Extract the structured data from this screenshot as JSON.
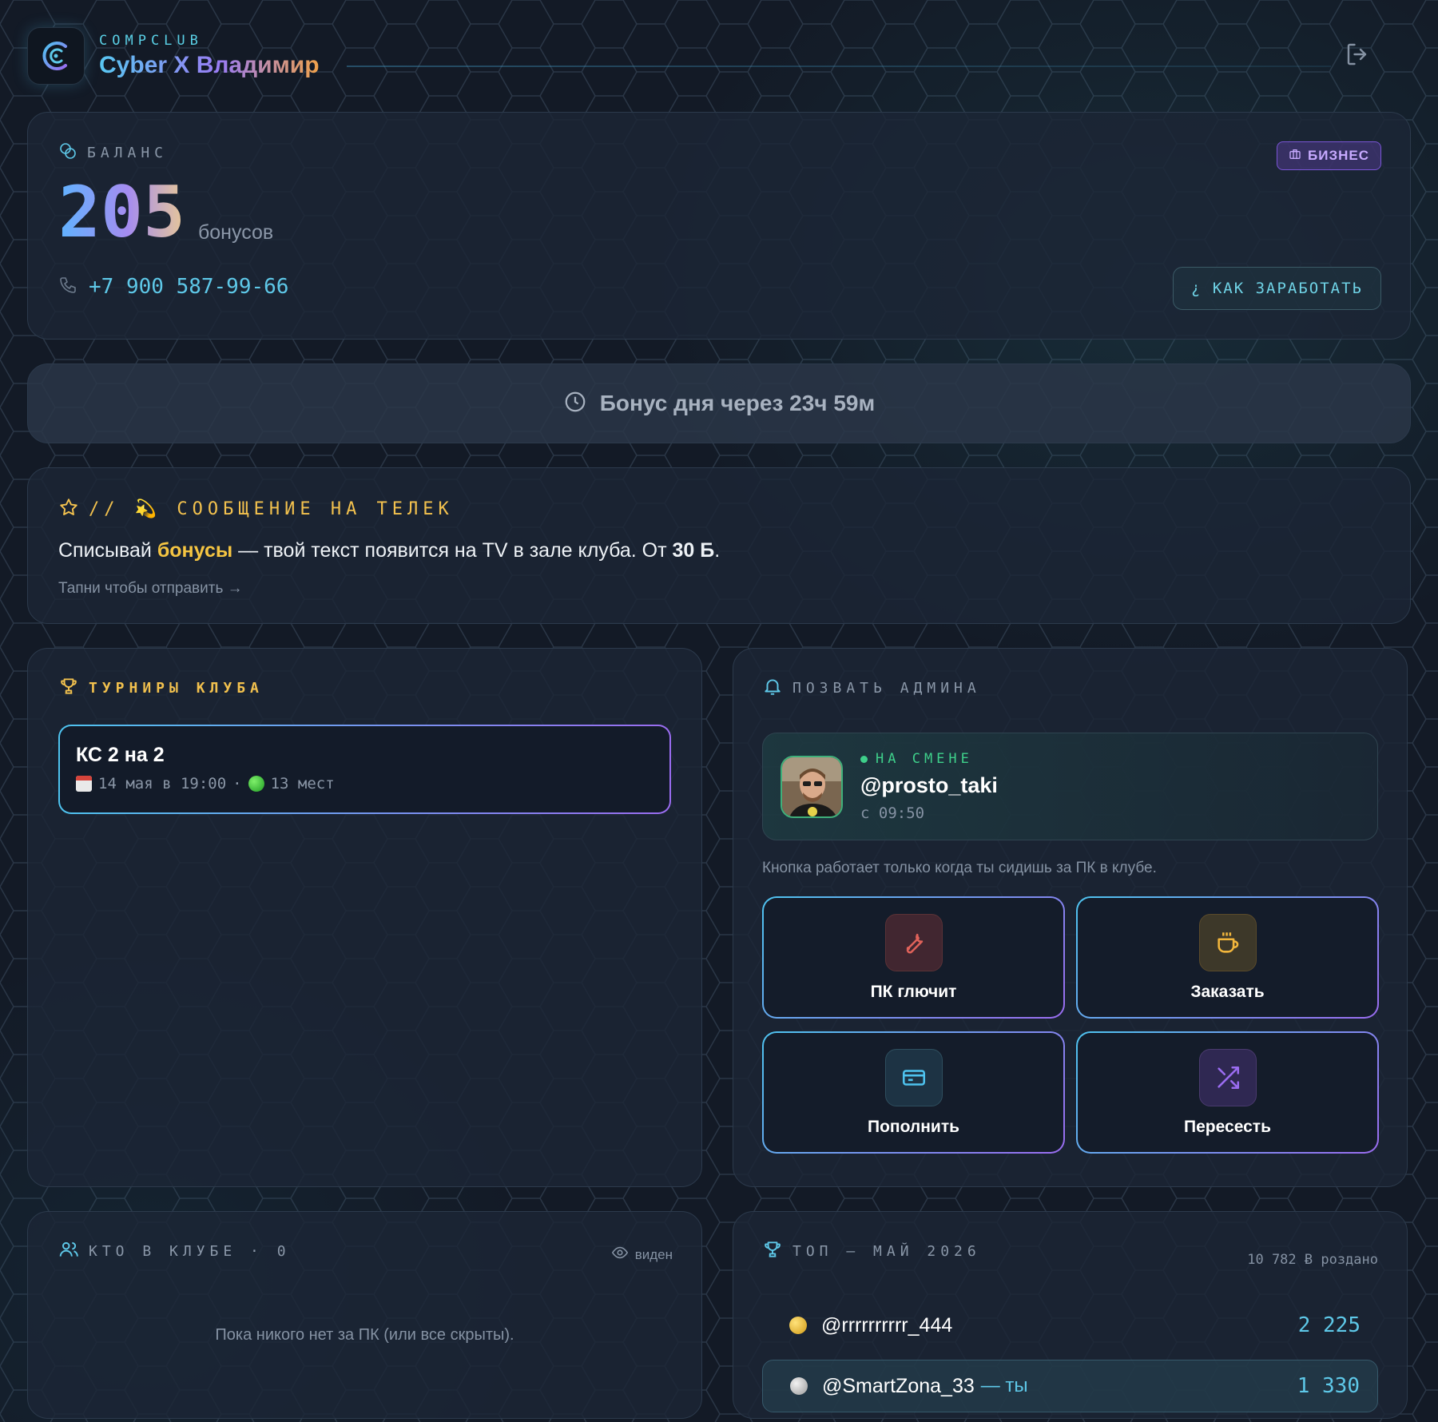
{
  "header": {
    "brand_small": "COMPCLUB",
    "brand_title": "Cyber X Владимир",
    "logo_icon": "c-logo-icon",
    "logout_icon": "logout-icon"
  },
  "balance": {
    "label": "БАЛАНС",
    "badge": "БИЗНЕС",
    "value": "205",
    "unit": "бонусов",
    "phone": "+7 900 587-99-66",
    "earn_button": "¿ КАК ЗАРАБОТАТЬ"
  },
  "daily_bonus": {
    "text": "Бонус дня через 23ч 59м"
  },
  "tv_message": {
    "title": "// 💫 СООБЩЕНИЕ НА ТЕЛЕК",
    "text_before": "Списывай ",
    "text_highlight": "бонусы",
    "text_middle": " — твой текст появится на TV в зале клуба. От ",
    "text_bold": "30 Б",
    "text_after": ".",
    "hint": "Тапни чтобы отправить →"
  },
  "tournaments": {
    "title": "ТУРНИРЫ КЛУБА",
    "items": [
      {
        "name": "КС 2 на 2",
        "date": "14 мая в 19:00",
        "sep": "·",
        "slots": "13 мест"
      }
    ]
  },
  "call_admin": {
    "title": "ПОЗВАТЬ АДМИНА",
    "status": "НА СМЕНЕ",
    "nick": "@prosto_taki",
    "since": "с 09:50",
    "note": "Кнопка работает только когда ты сидишь за ПК в клубе.",
    "actions": [
      {
        "label": "ПК глючит",
        "icon": "wrench-icon",
        "color": "#e0625a"
      },
      {
        "label": "Заказать",
        "icon": "coffee-icon",
        "color": "#f2b63c"
      },
      {
        "label": "Пополнить",
        "icon": "card-icon",
        "color": "#4ec3ef"
      },
      {
        "label": "Пересесть",
        "icon": "shuffle-icon",
        "color": "#9a6cf0"
      }
    ]
  },
  "who_in_club": {
    "title": "КТО В КЛУБЕ · 0",
    "visibility": "виден",
    "empty": "Пока никого нет за ПК (или все скрыты)."
  },
  "top": {
    "title": "ТОП — МАЙ 2026",
    "total": "10 782 Ƀ роздано",
    "rows": [
      {
        "nick": "@rrrrrrrrrr_444",
        "value": "2 225",
        "medal": "gold"
      },
      {
        "nick": "@SmartZona_33",
        "you": "— ты",
        "value": "1 330",
        "medal": "silver"
      }
    ]
  },
  "colors": {
    "accent": "#5ec8e8",
    "yellow": "#f2c14e",
    "purple": "#9a6cf0",
    "green": "#3ecf8a"
  }
}
